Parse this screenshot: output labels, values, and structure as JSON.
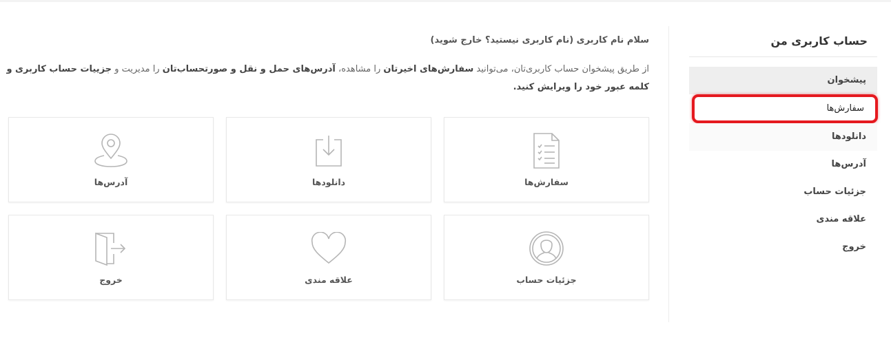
{
  "sidebar": {
    "title": "حساب کاربری من",
    "items": [
      {
        "label": "پیشخوان"
      },
      {
        "label": "سفارش‌ها"
      },
      {
        "label": "دانلودها"
      },
      {
        "label": "آدرس‌ها"
      },
      {
        "label": "جزئیات حساب"
      },
      {
        "label": "علاقه مندی"
      },
      {
        "label": "خروج"
      }
    ]
  },
  "main": {
    "greeting": "سلام نام کاربری (نام کاربری نیستید؟ خارج شوید)",
    "intro": {
      "p1": "از طریق پیشخوان حساب کاربری‌تان، می‌توانید ",
      "b1": "سفارش‌های اخیرتان",
      "p2": " را مشاهده، ",
      "b2": "آدرس‌های حمل و نقل و صورتحساب‌تان",
      "p3": " را مدیریت و ",
      "b3": "جزییات حساب کاربری و کلمه عبور خود را ویرایش کنید.",
      "p4": ""
    },
    "tiles": [
      {
        "label": "سفارش‌ها",
        "icon": "document-list-icon"
      },
      {
        "label": "دانلودها",
        "icon": "download-icon"
      },
      {
        "label": "آدرس‌ها",
        "icon": "map-pin-icon"
      },
      {
        "label": "جزئیات حساب",
        "icon": "user-icon"
      },
      {
        "label": "علاقه مندی",
        "icon": "heart-icon"
      },
      {
        "label": "خروج",
        "icon": "logout-door-icon"
      }
    ]
  },
  "colors": {
    "highlight_border": "#e5191f",
    "active_bg": "#eeeeee",
    "icon_stroke": "#b5b5b5"
  }
}
